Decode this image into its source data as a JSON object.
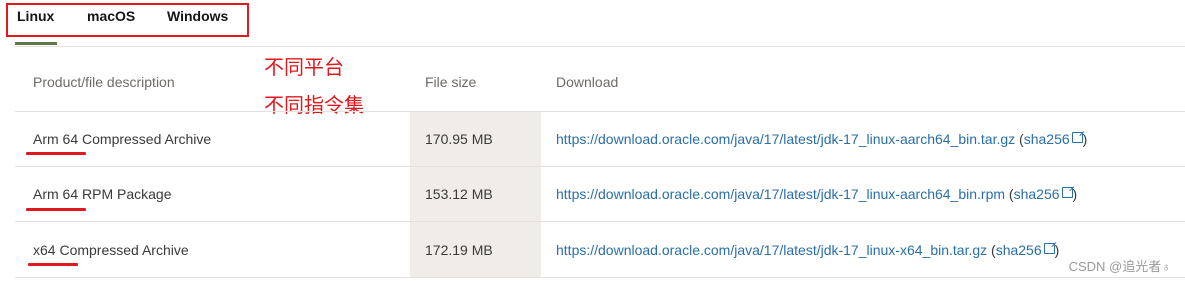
{
  "tabs": [
    "Linux",
    "macOS",
    "Windows"
  ],
  "annotation": {
    "line1": "不同平台",
    "line2": "不同指令集"
  },
  "table": {
    "headers": {
      "product": "Product/file description",
      "size": "File size",
      "download": "Download"
    },
    "rows": [
      {
        "product": "Arm 64 Compressed Archive",
        "size": "170.95 MB",
        "link": "https://download.oracle.com/java/17/latest/jdk-17_linux-aarch64_bin.tar.gz",
        "sha": "sha256",
        "open": " (",
        "close": ")"
      },
      {
        "product": "Arm 64 RPM Package",
        "size": "153.12 MB",
        "link": "https://download.oracle.com/java/17/latest/jdk-17_linux-aarch64_bin.rpm",
        "sha": "sha256",
        "open": " (",
        "close": ")"
      },
      {
        "product": "x64 Compressed Archive",
        "size": "172.19 MB",
        "link": "https://download.oracle.com/java/17/latest/jdk-17_linux-x64_bin.tar.gz",
        "sha": "sha256",
        "open": " (",
        "close": ")"
      }
    ]
  },
  "watermark": "CSDN @追光者♁",
  "colors": {
    "annotation_red": "#e0191e",
    "link_blue": "#2a6fa8",
    "active_tab_underline": "#5c7a48",
    "file_size_bg": "#f0ede9"
  }
}
